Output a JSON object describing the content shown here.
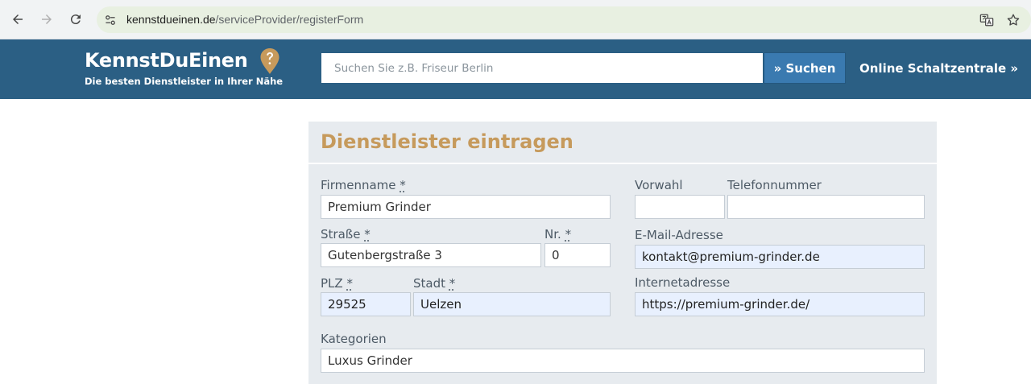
{
  "browser": {
    "url_domain": "kennstdueinen.de",
    "url_path": "/serviceProvider/registerForm"
  },
  "header": {
    "logo_title": "KennstDuEinen",
    "logo_tagline": "Die besten Dienstleister in Ihrer Nähe",
    "search_placeholder": "Suchen Sie z.B. Friseur Berlin",
    "search_button": "» Suchen",
    "online_link": "Online Schaltzentrale »"
  },
  "form": {
    "title": "Dienstleister eintragen",
    "required_mark": "*",
    "firmenname": {
      "label": "Firmenname",
      "value": "Premium Grinder"
    },
    "strasse": {
      "label": "Straße",
      "value": "Gutenbergstraße 3"
    },
    "nr": {
      "label": "Nr.",
      "value": "0"
    },
    "plz": {
      "label": "PLZ",
      "value": "29525"
    },
    "stadt": {
      "label": "Stadt",
      "value": "Uelzen"
    },
    "vorwahl": {
      "label": "Vorwahl",
      "value": ""
    },
    "telefon": {
      "label": "Telefonnummer",
      "value": ""
    },
    "email": {
      "label": "E-Mail-Adresse",
      "value": "kontakt@premium-grinder.de"
    },
    "internet": {
      "label": "Internetadresse",
      "value": "https://premium-grinder.de/"
    },
    "kategorien": {
      "label": "Kategorien",
      "value": "Luxus Grinder"
    }
  },
  "colors": {
    "header_bg": "#2b5f84",
    "title_gold": "#c69a5c",
    "panel_bg": "#e7ebef",
    "autofill_bg": "#e8f0fe"
  }
}
